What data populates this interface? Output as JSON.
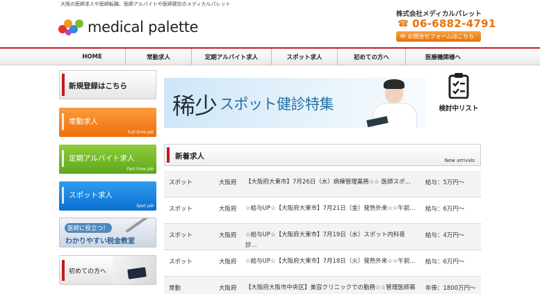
{
  "header": {
    "tagline": "大阪の医師求人や医師転職、医師アルバイトや医師健診のメディカルパレット",
    "logo_text": "medical palette",
    "company": "株式会社メディカルパレット",
    "phone_icon": "phone-icon",
    "phone": "06-6882-4791",
    "contact_label": "お問合せフォームはこちら",
    "contact_icon": "mail-icon"
  },
  "nav": {
    "items": [
      {
        "label": "HOME"
      },
      {
        "label": "常勤求人"
      },
      {
        "label": "定期アルバイト求人"
      },
      {
        "label": "スポット求人"
      },
      {
        "label": "初めての方へ"
      },
      {
        "label": "医療機関様へ"
      }
    ]
  },
  "sidebar": {
    "register": "新規登録はこちら",
    "fulltime": {
      "label": "常勤求人",
      "sub": "Full-time job"
    },
    "parttime": {
      "label": "定期アルバイト求人",
      "sub": "Part-time job"
    },
    "spot": {
      "label": "スポット求人",
      "sub": "Spot job"
    },
    "tax": {
      "line1": "医師に役立つ！",
      "line2": "わかりやすい税金教室"
    },
    "first": "初めての方へ"
  },
  "banner": {
    "big": "稀少",
    "mid": "スポット健診特集"
  },
  "review": {
    "icon": "clipboard-check-icon",
    "label": "検討中リスト"
  },
  "arrivals": {
    "title": "新着求人",
    "en": "New arrivals"
  },
  "jobs": [
    {
      "type": "スポット",
      "pref": "大阪府",
      "title": "【大阪府大東市】7月26日（水）病棟管理業務☆☆ 医師スポ...",
      "salary": "給与：5万円〜"
    },
    {
      "type": "スポット",
      "pref": "大阪府",
      "title": "☆給与UP☆【大阪府大東市】7月21日（金）発熱外来☆☆午前...",
      "salary": "給与：6万円〜"
    },
    {
      "type": "スポット",
      "pref": "大阪府",
      "title": "☆給与UP☆【大阪府大東市】7月19日（水）スポット内科夜診...",
      "salary": "給与：4万円〜"
    },
    {
      "type": "スポット",
      "pref": "大阪府",
      "title": "☆給与UP☆【大阪府大東市】7月18日（火）発熱外来☆☆午前...",
      "salary": "給与：6万円〜"
    },
    {
      "type": "常勤",
      "pref": "大阪府",
      "title": "【大阪府大阪市中央区】美容クリニックでの勤務☆☆管理医師募集...",
      "salary": "年俸：1800万円〜"
    }
  ],
  "colors": {
    "accent_red": "#c41a1a",
    "orange": "#ee6f0a",
    "green": "#5ea81b",
    "blue": "#0a6fd0"
  }
}
